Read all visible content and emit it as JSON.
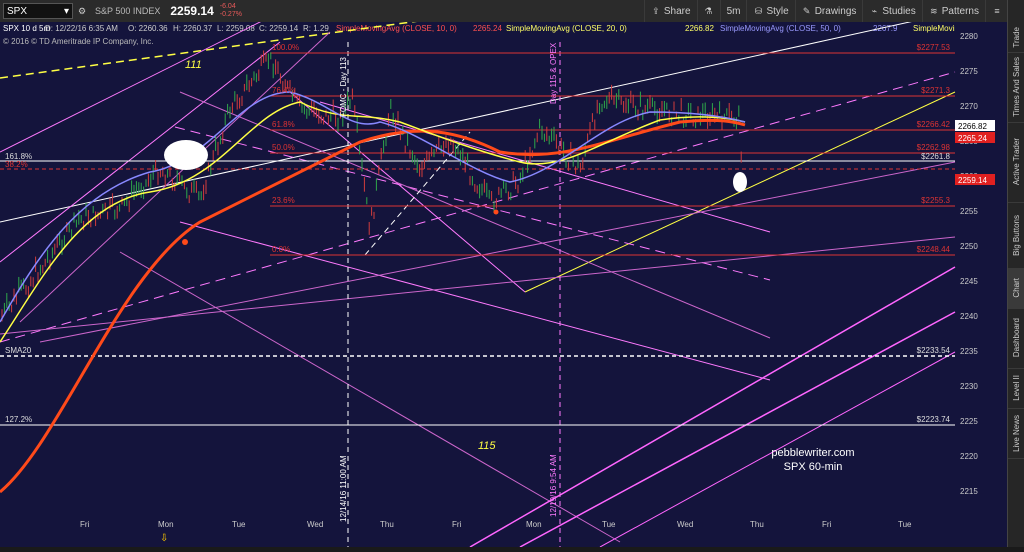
{
  "toolbar": {
    "symbol": "SPX",
    "symbol_name": "S&P 500 INDEX",
    "last_price": "2259.14",
    "change": "-6.04",
    "change_pct": "-0.27%",
    "buttons": {
      "share": "Share",
      "style": "Style",
      "drawings": "Drawings",
      "studies": "Studies",
      "patterns": "Patterns",
      "timeframe": "5m"
    }
  },
  "chart_header": {
    "info": "SPX 10 d 5m",
    "datetime": "D: 12/22/16 6:35 AM",
    "open": "O: 2260.36",
    "high": "H: 2260.37",
    "low": "L: 2259.08",
    "close": "C: 2259.14",
    "range": "R: 1.29",
    "sma10": "SimpleMovingAvg (CLOSE, 10, 0)",
    "sma10_val": "2265.24",
    "sma20": "SimpleMovingAvg (CLOSE, 20, 0)",
    "sma20_val": "2266.82",
    "sma50": "SimpleMovingAvg (CLOSE, 50, 0)",
    "sma50_val": "2267.9",
    "sma_more": "SimpleMoving...",
    "copyright": "© 2016 © TD Ameritrade IP Company, Inc."
  },
  "price_axis": [
    "2280",
    "2275",
    "2270",
    "2265",
    "2260",
    "2255",
    "2250",
    "2245",
    "2240",
    "2235",
    "2230",
    "2225",
    "2220",
    "2215"
  ],
  "price_badges": {
    "p1": "2266.82",
    "p2": "2265.24",
    "p3": "2259.14"
  },
  "level_labels": [
    "$2277.53",
    "$2271.3",
    "$2266.42",
    "$2262.98",
    "$2261.8",
    "$2255.3",
    "$2248.44",
    "$2233.54",
    "$2223.74"
  ],
  "fib_labels": [
    "100.0%",
    "76.4%",
    "61.8%",
    "50.0%",
    "38.2%",
    "23.6%",
    "0.0%",
    "161.8%",
    "127.2%",
    "SMA20"
  ],
  "x_axis": [
    "Fri",
    "Mon",
    "Tue",
    "Wed",
    "Thu",
    "Fri",
    "Mon",
    "Tue",
    "Wed",
    "Thu",
    "Fri",
    "Tue"
  ],
  "annotations": {
    "wave111": "111",
    "wave115": "115",
    "fomc_top": "FOMC - Day 113",
    "opex_top": "Day 115 & OPEX",
    "vline1": "12/14/16 11:00 AM",
    "vline2": "12/19/16 9:54 AM",
    "watermark1": "pebblewriter.com",
    "watermark2": "SPX 60-min"
  },
  "side_tabs": [
    "Trade",
    "Times And Sales",
    "Active Trader",
    "Big Buttons",
    "Chart",
    "Dashboard",
    "Level II",
    "Live News"
  ],
  "colors": {
    "background": "#14143c",
    "candle_up": "#2fa84a",
    "candle_down": "#d23c3c",
    "sma10": "#ff4444",
    "sma20": "#ffff44",
    "sma50": "#8888ff",
    "fib": "#d33"
  }
}
